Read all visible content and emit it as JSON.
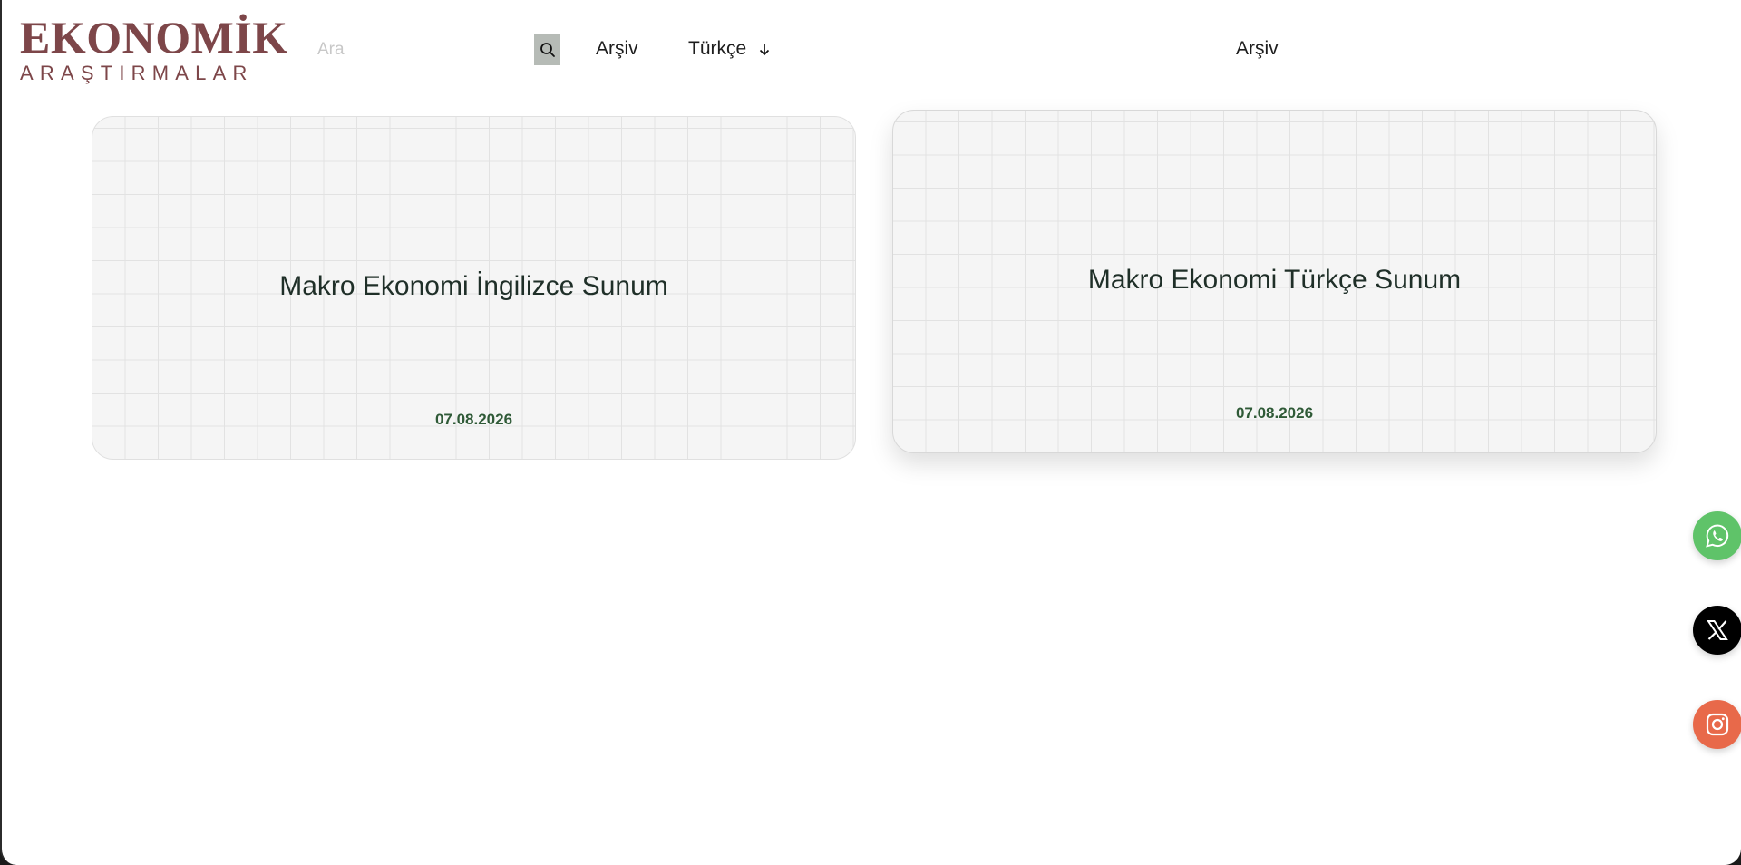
{
  "logo": {
    "main": "EKONOMİK",
    "sub": "ARAŞTIRMALAR",
    "color": "#7d4649"
  },
  "search": {
    "placeholder": "Ara",
    "value": "",
    "icon": "search-icon"
  },
  "nav": {
    "archive_left": "Arşiv",
    "language": "Türkçe",
    "language_icon": "arrow-down-icon",
    "archive_right": "Arşiv"
  },
  "cards": [
    {
      "title": "Makro Ekonomi İngilizce Sunum",
      "date": "07.08.2026"
    },
    {
      "title": "Makro Ekonomi Türkçe Sunum",
      "date": "07.08.2026"
    }
  ],
  "social": [
    {
      "name": "whatsapp-icon",
      "color": "#5fc369"
    },
    {
      "name": "x-icon",
      "color": "#000000"
    },
    {
      "name": "instagram-icon",
      "color": "#e8694a"
    }
  ],
  "colors": {
    "date_green": "#2f5a37",
    "title": "#1f2f28",
    "search_button": "#b6bbb6"
  }
}
